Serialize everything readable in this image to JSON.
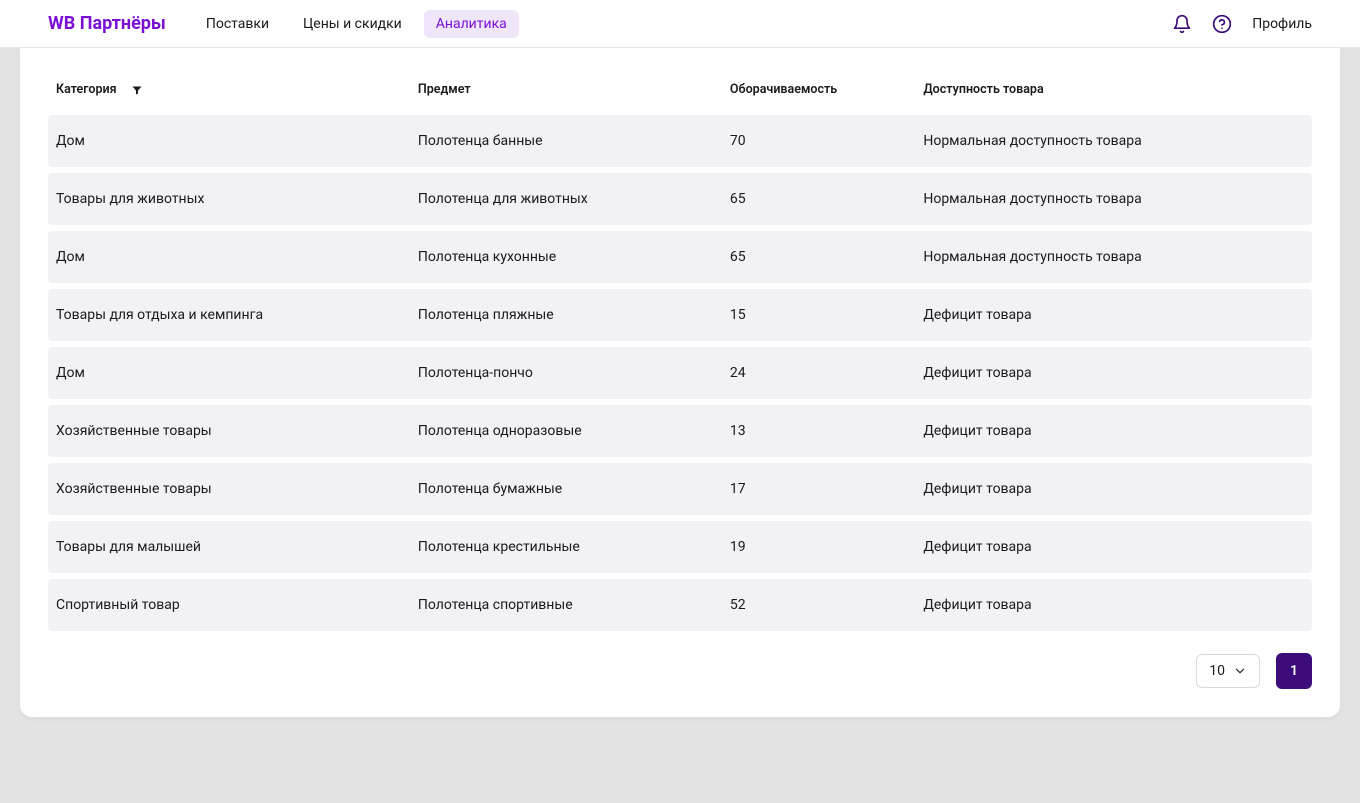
{
  "brand": "WB Партнёры",
  "nav": {
    "items": [
      {
        "label": "Поставки",
        "active": false
      },
      {
        "label": "Цены и скидки",
        "active": false
      },
      {
        "label": "Аналитика",
        "active": true
      }
    ]
  },
  "topbar": {
    "profile_label": "Профиль"
  },
  "table": {
    "headers": {
      "category": "Категория",
      "item": "Предмет",
      "turnover": "Оборачиваемость",
      "availability": "Доступность товара"
    },
    "rows": [
      {
        "category": "Дом",
        "item": "Полотенца банные",
        "turnover": "70",
        "availability": "Нормальная доступность товара"
      },
      {
        "category": "Товары для животных",
        "item": "Полотенца для животных",
        "turnover": "65",
        "availability": "Нормальная доступность товара"
      },
      {
        "category": "Дом",
        "item": "Полотенца кухонные",
        "turnover": "65",
        "availability": "Нормальная доступность товара"
      },
      {
        "category": "Товары для отдыха и кемпинга",
        "item": "Полотенца пляжные",
        "turnover": "15",
        "availability": "Дефицит товара"
      },
      {
        "category": "Дом",
        "item": "Полотенца-пончо",
        "turnover": "24",
        "availability": "Дефицит товара"
      },
      {
        "category": "Хозяйственные товары",
        "item": "Полотенца одноразовые",
        "turnover": "13",
        "availability": "Дефицит товара"
      },
      {
        "category": "Хозяйственные товары",
        "item": "Полотенца бумажные",
        "turnover": "17",
        "availability": "Дефицит товара"
      },
      {
        "category": "Товары для малышей",
        "item": "Полотенца крестильные",
        "turnover": "19",
        "availability": "Дефицит товара"
      },
      {
        "category": "Спортивный товар",
        "item": "Полотенца спортивные",
        "turnover": "52",
        "availability": "Дефицит товара"
      }
    ]
  },
  "pagination": {
    "page_size": "10",
    "current_page": "1"
  },
  "colors": {
    "brand": "#7b10d4",
    "brand_dark": "#3b0c7a",
    "row_bg": "#f2f1f5",
    "nav_active_bg": "#f0e6fa"
  }
}
